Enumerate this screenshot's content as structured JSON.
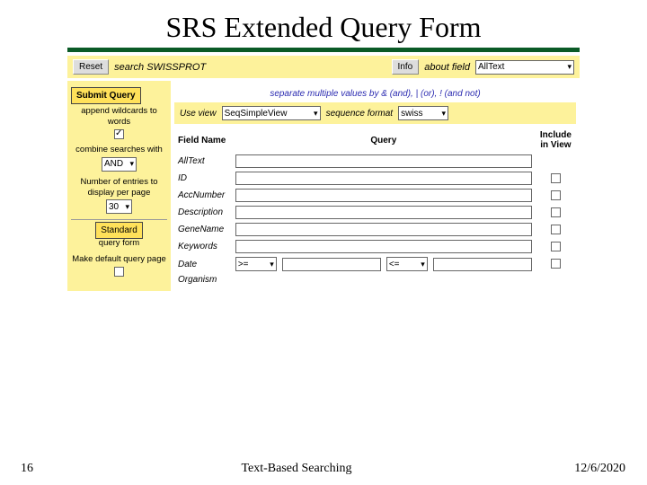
{
  "title": "SRS Extended Query Form",
  "topbar": {
    "reset": "Reset",
    "search_label": "search SWISSPROT",
    "info": "Info",
    "about_label": "about field",
    "about_select": "AllText"
  },
  "hint": "separate multiple values by & (and), | (or), ! (and not)",
  "viewbar": {
    "use_view_label": "Use view",
    "use_view_select": "SeqSimpleView",
    "seqfmt_label": "sequence format",
    "seqfmt_select": "swiss"
  },
  "sidebar": {
    "submit": "Submit Query",
    "wildcards_label": "append wildcards to words",
    "combine_label": "combine searches with",
    "combine_select": "AND",
    "entries_label": "Number of entries to display per page",
    "entries_select": "30",
    "standard": "Standard",
    "queryform_label": "query form",
    "default_label": "Make default query page"
  },
  "headers": {
    "field": "Field Name",
    "query": "Query",
    "include": "Include in View"
  },
  "fields": [
    {
      "name": "AllText",
      "include": null
    },
    {
      "name": "ID",
      "include": false
    },
    {
      "name": "AccNumber",
      "include": false
    },
    {
      "name": "Description",
      "include": false
    },
    {
      "name": "GeneName",
      "include": false
    },
    {
      "name": "Keywords",
      "include": false
    }
  ],
  "date_row": {
    "name": "Date",
    "op1": ">=",
    "op2": "<=",
    "include": false
  },
  "last_row": {
    "name": "Organism"
  },
  "footer": {
    "page": "16",
    "mid": "Text-Based Searching",
    "date": "12/6/2020"
  }
}
